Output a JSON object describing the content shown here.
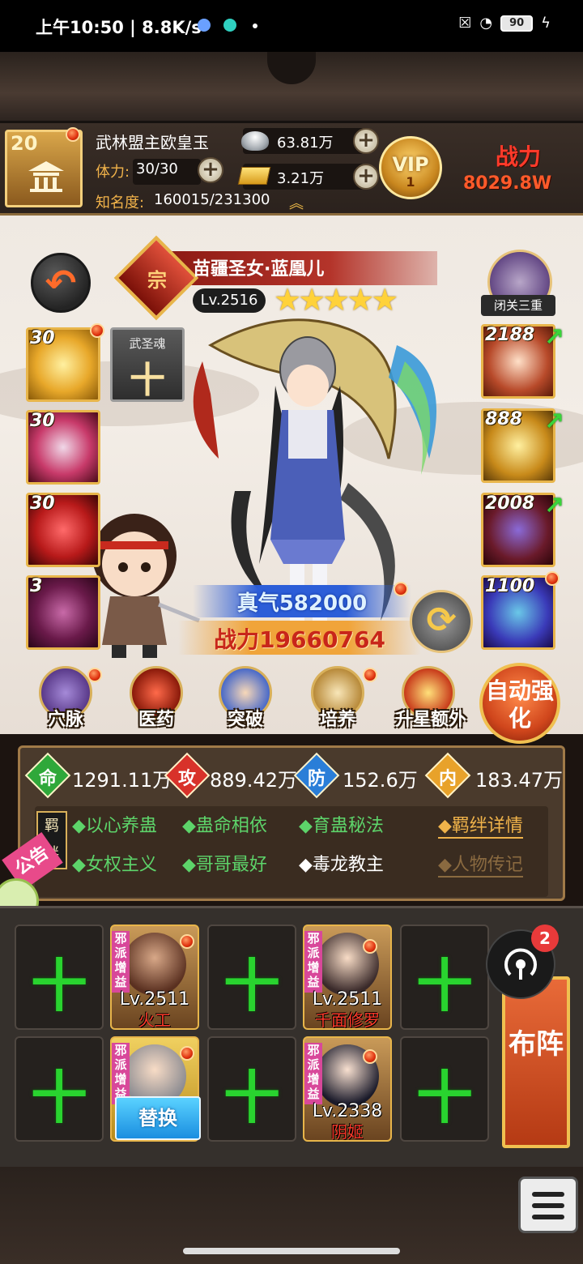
{
  "status_bar": {
    "time": "上午10:50 | 8.8K/s",
    "battery": "90"
  },
  "player": {
    "level": "20",
    "name": "武林盟主欧皇玉",
    "stamina_label": "体力:",
    "stamina": "30/30",
    "fame_label": "知名度:",
    "fame": "160015/231300",
    "silver": "63.81万",
    "gold": "3.21万",
    "vip_label": "VIP",
    "vip_level": "1",
    "power_label": "战力",
    "power_value": "8029.8W"
  },
  "hero": {
    "badge": "宗",
    "name": "苗疆圣女·蓝凰儿",
    "level": "Lv.2516",
    "stars": "★★★★★",
    "retreat_label": "闭关三重",
    "qi": "真气582000",
    "power": "战力19660764",
    "wusheng_label": "武圣魂",
    "wusheng_plus": "十"
  },
  "left_slots": [
    "30",
    "30",
    "30",
    "3"
  ],
  "right_slots": [
    "2188",
    "888",
    "2008",
    "1100"
  ],
  "functions": [
    "穴脉",
    "医药",
    "突破",
    "培养",
    "升星额外"
  ],
  "auto_button": "自动强化",
  "attributes": [
    {
      "icon": "命",
      "value": "1291.11万",
      "color": "#2fa83a"
    },
    {
      "icon": "攻",
      "value": "889.42万",
      "color": "#d8322a"
    },
    {
      "icon": "防",
      "value": "152.6万",
      "color": "#2a7ed8"
    },
    {
      "icon": "内",
      "value": "183.47万",
      "color": "#e8a22a"
    }
  ],
  "bonds": {
    "tag": "羁绊",
    "row1": [
      "◆以心养蛊",
      "◆蛊命相依",
      "◆育蛊秘法"
    ],
    "row2": [
      "◆女权主义",
      "◆哥哥最好",
      "◆毒龙教主"
    ],
    "link1": "◆羁绊详情",
    "link2": "◆人物传记"
  },
  "notice": "公告",
  "formation": {
    "plus": "十",
    "tag": "邪派增益",
    "heroes": [
      {
        "level": "Lv.2511",
        "name": "火工"
      },
      {
        "level": "Lv.2511",
        "name": "千面修罗"
      },
      {
        "level": "Lv.2338",
        "name": "阴姬"
      }
    ],
    "replace": "替换",
    "buzhen": "布阵",
    "share_badge": "2"
  }
}
